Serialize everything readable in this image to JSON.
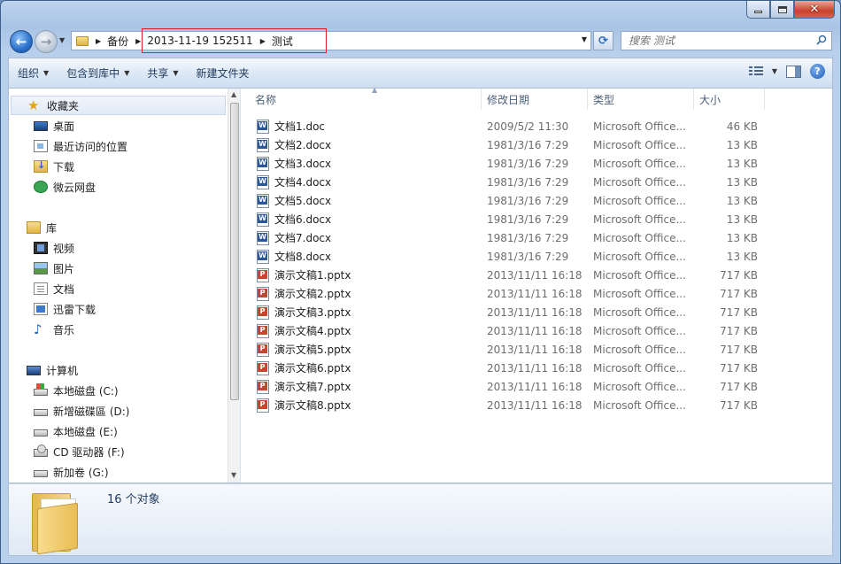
{
  "window": {
    "caption": {
      "minimize_glyph": "—",
      "maximize_glyph": "□",
      "close_glyph": "✕"
    }
  },
  "nav": {
    "breadcrumb": [
      "备份",
      "2013-11-19 152511",
      "测试"
    ],
    "search_placeholder": "搜索 测试"
  },
  "toolbar": {
    "organize": "组织",
    "include_in_library": "包含到库中",
    "share": "共享",
    "new_folder": "新建文件夹"
  },
  "sidebar": {
    "favorites": {
      "label": "收藏夹",
      "items": [
        "桌面",
        "最近访问的位置",
        "下载",
        "微云网盘"
      ]
    },
    "libraries": {
      "label": "库",
      "items": [
        "视频",
        "图片",
        "文档",
        "迅雷下载",
        "音乐"
      ]
    },
    "computer": {
      "label": "计算机",
      "items": [
        "本地磁盘 (C:)",
        "新增磁碟區 (D:)",
        "本地磁盘 (E:)",
        "CD 驱动器 (F:)",
        "新加卷 (G:)"
      ]
    }
  },
  "columns": [
    "名称",
    "修改日期",
    "类型",
    "大小"
  ],
  "files": [
    {
      "name": "文档1.doc",
      "date": "2009/5/2 11:30",
      "type": "Microsoft Office...",
      "size": "46 KB",
      "kind": "word"
    },
    {
      "name": "文档2.docx",
      "date": "1981/3/16 7:29",
      "type": "Microsoft Office...",
      "size": "13 KB",
      "kind": "word"
    },
    {
      "name": "文档3.docx",
      "date": "1981/3/16 7:29",
      "type": "Microsoft Office...",
      "size": "13 KB",
      "kind": "word"
    },
    {
      "name": "文档4.docx",
      "date": "1981/3/16 7:29",
      "type": "Microsoft Office...",
      "size": "13 KB",
      "kind": "word"
    },
    {
      "name": "文档5.docx",
      "date": "1981/3/16 7:29",
      "type": "Microsoft Office...",
      "size": "13 KB",
      "kind": "word"
    },
    {
      "name": "文档6.docx",
      "date": "1981/3/16 7:29",
      "type": "Microsoft Office...",
      "size": "13 KB",
      "kind": "word"
    },
    {
      "name": "文档7.docx",
      "date": "1981/3/16 7:29",
      "type": "Microsoft Office...",
      "size": "13 KB",
      "kind": "word"
    },
    {
      "name": "文档8.docx",
      "date": "1981/3/16 7:29",
      "type": "Microsoft Office...",
      "size": "13 KB",
      "kind": "word"
    },
    {
      "name": "演示文稿1.pptx",
      "date": "2013/11/11 16:18",
      "type": "Microsoft Office...",
      "size": "717 KB",
      "kind": "ppt"
    },
    {
      "name": "演示文稿2.pptx",
      "date": "2013/11/11 16:18",
      "type": "Microsoft Office...",
      "size": "717 KB",
      "kind": "ppt"
    },
    {
      "name": "演示文稿3.pptx",
      "date": "2013/11/11 16:18",
      "type": "Microsoft Office...",
      "size": "717 KB",
      "kind": "ppt"
    },
    {
      "name": "演示文稿4.pptx",
      "date": "2013/11/11 16:18",
      "type": "Microsoft Office...",
      "size": "717 KB",
      "kind": "ppt"
    },
    {
      "name": "演示文稿5.pptx",
      "date": "2013/11/11 16:18",
      "type": "Microsoft Office...",
      "size": "717 KB",
      "kind": "ppt"
    },
    {
      "name": "演示文稿6.pptx",
      "date": "2013/11/11 16:18",
      "type": "Microsoft Office...",
      "size": "717 KB",
      "kind": "ppt"
    },
    {
      "name": "演示文稿7.pptx",
      "date": "2013/11/11 16:18",
      "type": "Microsoft Office...",
      "size": "717 KB",
      "kind": "ppt"
    },
    {
      "name": "演示文稿8.pptx",
      "date": "2013/11/11 16:18",
      "type": "Microsoft Office...",
      "size": "717 KB",
      "kind": "ppt"
    }
  ],
  "details": {
    "count_text": "16 个对象"
  },
  "colors": {
    "highlight_box": "#e02020",
    "accent": "#1e395b"
  }
}
